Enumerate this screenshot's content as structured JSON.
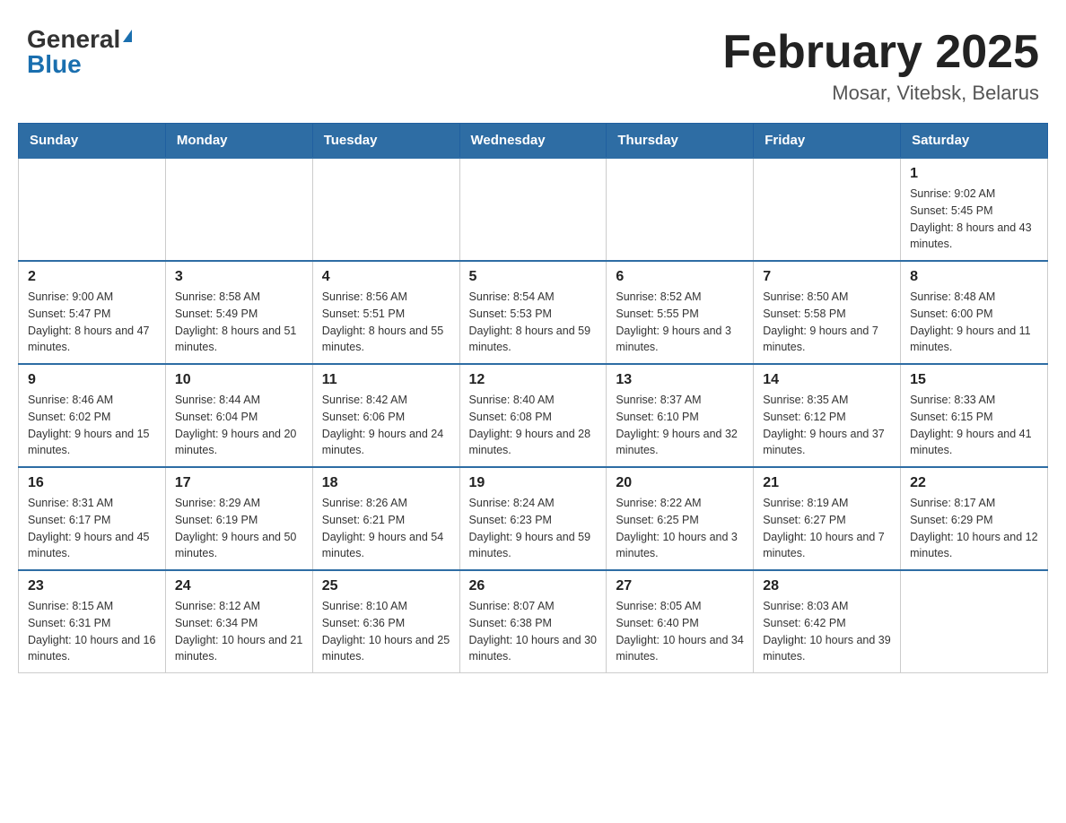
{
  "header": {
    "logo_general": "General",
    "logo_blue": "Blue",
    "title": "February 2025",
    "subtitle": "Mosar, Vitebsk, Belarus"
  },
  "days_of_week": [
    "Sunday",
    "Monday",
    "Tuesday",
    "Wednesday",
    "Thursday",
    "Friday",
    "Saturday"
  ],
  "weeks": [
    [
      {
        "day": "",
        "info": ""
      },
      {
        "day": "",
        "info": ""
      },
      {
        "day": "",
        "info": ""
      },
      {
        "day": "",
        "info": ""
      },
      {
        "day": "",
        "info": ""
      },
      {
        "day": "",
        "info": ""
      },
      {
        "day": "1",
        "info": "Sunrise: 9:02 AM\nSunset: 5:45 PM\nDaylight: 8 hours and 43 minutes."
      }
    ],
    [
      {
        "day": "2",
        "info": "Sunrise: 9:00 AM\nSunset: 5:47 PM\nDaylight: 8 hours and 47 minutes."
      },
      {
        "day": "3",
        "info": "Sunrise: 8:58 AM\nSunset: 5:49 PM\nDaylight: 8 hours and 51 minutes."
      },
      {
        "day": "4",
        "info": "Sunrise: 8:56 AM\nSunset: 5:51 PM\nDaylight: 8 hours and 55 minutes."
      },
      {
        "day": "5",
        "info": "Sunrise: 8:54 AM\nSunset: 5:53 PM\nDaylight: 8 hours and 59 minutes."
      },
      {
        "day": "6",
        "info": "Sunrise: 8:52 AM\nSunset: 5:55 PM\nDaylight: 9 hours and 3 minutes."
      },
      {
        "day": "7",
        "info": "Sunrise: 8:50 AM\nSunset: 5:58 PM\nDaylight: 9 hours and 7 minutes."
      },
      {
        "day": "8",
        "info": "Sunrise: 8:48 AM\nSunset: 6:00 PM\nDaylight: 9 hours and 11 minutes."
      }
    ],
    [
      {
        "day": "9",
        "info": "Sunrise: 8:46 AM\nSunset: 6:02 PM\nDaylight: 9 hours and 15 minutes."
      },
      {
        "day": "10",
        "info": "Sunrise: 8:44 AM\nSunset: 6:04 PM\nDaylight: 9 hours and 20 minutes."
      },
      {
        "day": "11",
        "info": "Sunrise: 8:42 AM\nSunset: 6:06 PM\nDaylight: 9 hours and 24 minutes."
      },
      {
        "day": "12",
        "info": "Sunrise: 8:40 AM\nSunset: 6:08 PM\nDaylight: 9 hours and 28 minutes."
      },
      {
        "day": "13",
        "info": "Sunrise: 8:37 AM\nSunset: 6:10 PM\nDaylight: 9 hours and 32 minutes."
      },
      {
        "day": "14",
        "info": "Sunrise: 8:35 AM\nSunset: 6:12 PM\nDaylight: 9 hours and 37 minutes."
      },
      {
        "day": "15",
        "info": "Sunrise: 8:33 AM\nSunset: 6:15 PM\nDaylight: 9 hours and 41 minutes."
      }
    ],
    [
      {
        "day": "16",
        "info": "Sunrise: 8:31 AM\nSunset: 6:17 PM\nDaylight: 9 hours and 45 minutes."
      },
      {
        "day": "17",
        "info": "Sunrise: 8:29 AM\nSunset: 6:19 PM\nDaylight: 9 hours and 50 minutes."
      },
      {
        "day": "18",
        "info": "Sunrise: 8:26 AM\nSunset: 6:21 PM\nDaylight: 9 hours and 54 minutes."
      },
      {
        "day": "19",
        "info": "Sunrise: 8:24 AM\nSunset: 6:23 PM\nDaylight: 9 hours and 59 minutes."
      },
      {
        "day": "20",
        "info": "Sunrise: 8:22 AM\nSunset: 6:25 PM\nDaylight: 10 hours and 3 minutes."
      },
      {
        "day": "21",
        "info": "Sunrise: 8:19 AM\nSunset: 6:27 PM\nDaylight: 10 hours and 7 minutes."
      },
      {
        "day": "22",
        "info": "Sunrise: 8:17 AM\nSunset: 6:29 PM\nDaylight: 10 hours and 12 minutes."
      }
    ],
    [
      {
        "day": "23",
        "info": "Sunrise: 8:15 AM\nSunset: 6:31 PM\nDaylight: 10 hours and 16 minutes."
      },
      {
        "day": "24",
        "info": "Sunrise: 8:12 AM\nSunset: 6:34 PM\nDaylight: 10 hours and 21 minutes."
      },
      {
        "day": "25",
        "info": "Sunrise: 8:10 AM\nSunset: 6:36 PM\nDaylight: 10 hours and 25 minutes."
      },
      {
        "day": "26",
        "info": "Sunrise: 8:07 AM\nSunset: 6:38 PM\nDaylight: 10 hours and 30 minutes."
      },
      {
        "day": "27",
        "info": "Sunrise: 8:05 AM\nSunset: 6:40 PM\nDaylight: 10 hours and 34 minutes."
      },
      {
        "day": "28",
        "info": "Sunrise: 8:03 AM\nSunset: 6:42 PM\nDaylight: 10 hours and 39 minutes."
      },
      {
        "day": "",
        "info": ""
      }
    ]
  ]
}
